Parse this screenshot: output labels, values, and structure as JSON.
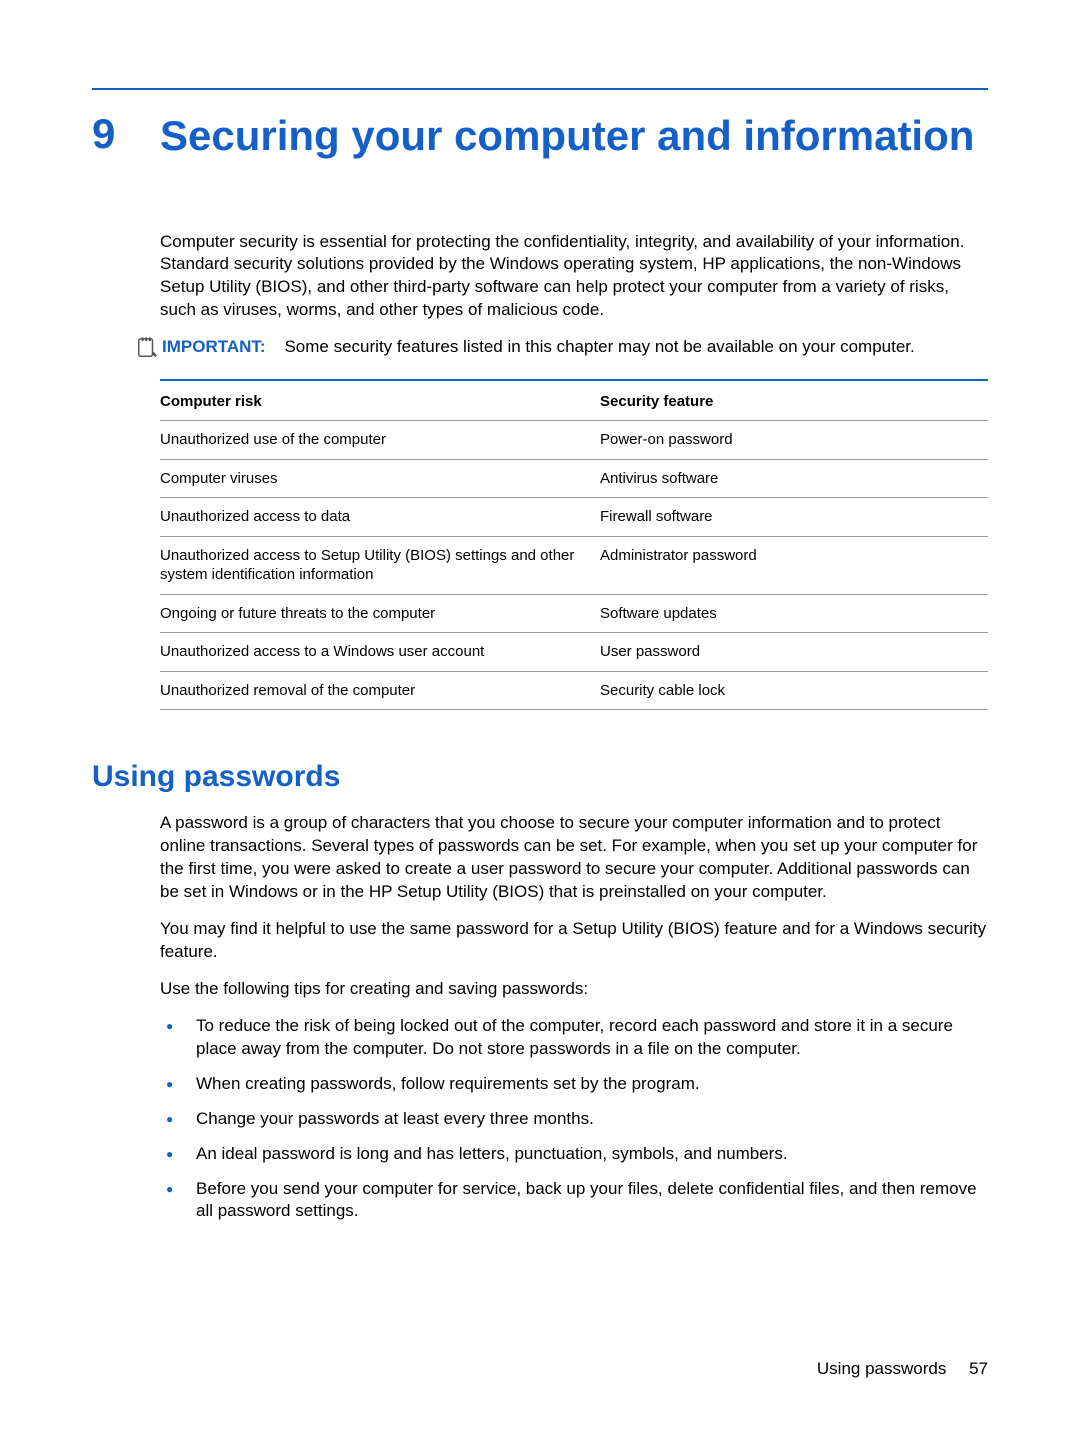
{
  "chapter": {
    "number": "9",
    "title": "Securing your computer and information"
  },
  "intro": "Computer security is essential for protecting the confidentiality, integrity, and availability of your information. Standard security solutions provided by the Windows operating system, HP applications, the non-Windows Setup Utility (BIOS), and other third-party software can help protect your computer from a variety of risks, such as viruses, worms, and other types of malicious code.",
  "important": {
    "label": "IMPORTANT:",
    "text": "Some security features listed in this chapter may not be available on your computer."
  },
  "table": {
    "header": {
      "risk": "Computer risk",
      "feature": "Security feature"
    },
    "rows": [
      {
        "risk": "Unauthorized use of the computer",
        "feature": "Power-on password"
      },
      {
        "risk": "Computer viruses",
        "feature": "Antivirus software"
      },
      {
        "risk": "Unauthorized access to data",
        "feature": "Firewall software"
      },
      {
        "risk": "Unauthorized access to Setup Utility (BIOS) settings and other system identification information",
        "feature": "Administrator password"
      },
      {
        "risk": "Ongoing or future threats to the computer",
        "feature": "Software updates"
      },
      {
        "risk": "Unauthorized access to a Windows user account",
        "feature": "User password"
      },
      {
        "risk": "Unauthorized removal of the computer",
        "feature": "Security cable lock"
      }
    ]
  },
  "section": {
    "title": "Using passwords",
    "p1": "A password is a group of characters that you choose to secure your computer information and to protect online transactions. Several types of passwords can be set. For example, when you set up your computer for the first time, you were asked to create a user password to secure your computer. Additional passwords can be set in Windows or in the HP Setup Utility (BIOS) that is preinstalled on your computer.",
    "p2": "You may find it helpful to use the same password for a Setup Utility (BIOS) feature and for a Windows security feature.",
    "p3": "Use the following tips for creating and saving passwords:",
    "bullets": [
      "To reduce the risk of being locked out of the computer, record each password and store it in a secure place away from the computer. Do not store passwords in a file on the computer.",
      "When creating passwords, follow requirements set by the program.",
      "Change your passwords at least every three months.",
      "An ideal password is long and has letters, punctuation, symbols, and numbers.",
      "Before you send your computer for service, back up your files, delete confidential files, and then remove all password settings."
    ]
  },
  "footer": {
    "label": "Using passwords",
    "page": "57"
  }
}
